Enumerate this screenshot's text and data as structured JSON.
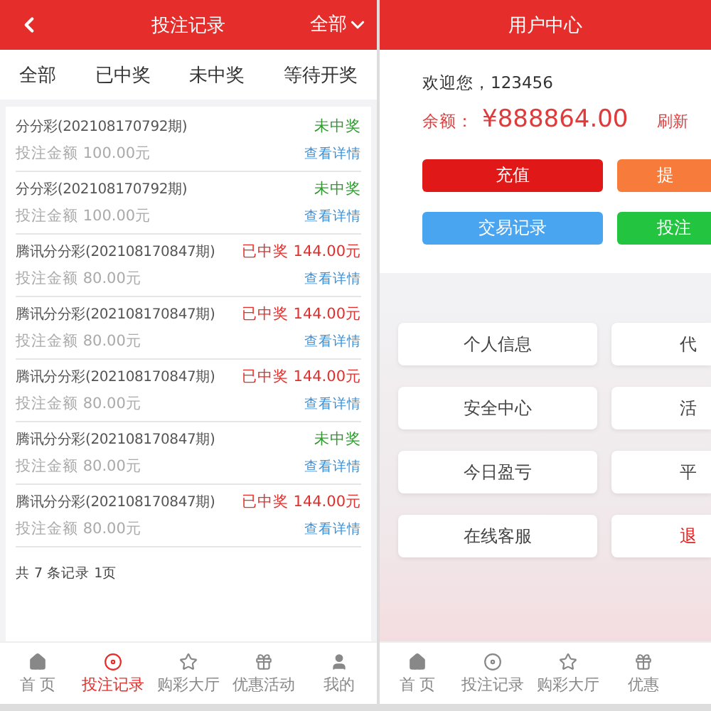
{
  "records_screen": {
    "header": {
      "title": "投注记录",
      "filter": "全部"
    },
    "tabs": [
      {
        "label": "全部"
      },
      {
        "label": "已中奖"
      },
      {
        "label": "未中奖"
      },
      {
        "label": "等待开奖"
      }
    ],
    "records": [
      {
        "name": "分分彩(202108170792期)",
        "kind": "lost",
        "status": "未中奖",
        "amount": "投注金额 100.00元",
        "link": "查看详情"
      },
      {
        "name": "分分彩(202108170792期)",
        "kind": "lost",
        "status": "未中奖",
        "amount": "投注金额 100.00元",
        "link": "查看详情"
      },
      {
        "name": "腾讯分分彩(202108170847期)",
        "kind": "won",
        "status": "已中奖 144.00元",
        "amount": "投注金额 80.00元",
        "link": "查看详情"
      },
      {
        "name": "腾讯分分彩(202108170847期)",
        "kind": "won",
        "status": "已中奖 144.00元",
        "amount": "投注金额 80.00元",
        "link": "查看详情"
      },
      {
        "name": "腾讯分分彩(202108170847期)",
        "kind": "won",
        "status": "已中奖 144.00元",
        "amount": "投注金额 80.00元",
        "link": "查看详情"
      },
      {
        "name": "腾讯分分彩(202108170847期)",
        "kind": "lost",
        "status": "未中奖",
        "amount": "投注金额 80.00元",
        "link": "查看详情"
      },
      {
        "name": "腾讯分分彩(202108170847期)",
        "kind": "won",
        "status": "已中奖 144.00元",
        "amount": "投注金额 80.00元",
        "link": "查看详情"
      }
    ],
    "summary": "共 7 条记录 1页",
    "nav": [
      {
        "label": "首 页",
        "kind": "home",
        "selected": false
      },
      {
        "label": "投注记录",
        "kind": "target",
        "selected": true
      },
      {
        "label": "购彩大厅",
        "kind": "star",
        "selected": false
      },
      {
        "label": "优惠活动",
        "kind": "gift",
        "selected": false
      },
      {
        "label": "我的",
        "kind": "user",
        "selected": false
      }
    ]
  },
  "user_screen": {
    "title": "用户中心",
    "welcome": "欢迎您，123456",
    "balance_label": "余额：",
    "balance": "¥888864.00",
    "refresh": "刷新",
    "actions": [
      {
        "label": "充值",
        "color": "#e01818"
      },
      {
        "label": "提",
        "color": "#f77b3b"
      },
      {
        "label": "交易记录",
        "color": "#4aa5f0"
      },
      {
        "label": "投注",
        "color": "#22c440"
      }
    ],
    "menu": [
      {
        "label": "个人信息",
        "kind": "normal"
      },
      {
        "label": "代",
        "kind": "normal"
      },
      {
        "label": "安全中心",
        "kind": "normal"
      },
      {
        "label": "活",
        "kind": "normal"
      },
      {
        "label": "今日盈亏",
        "kind": "normal"
      },
      {
        "label": "平",
        "kind": "normal"
      },
      {
        "label": "在线客服",
        "kind": "normal"
      },
      {
        "label": "退",
        "kind": "danger"
      }
    ],
    "nav": [
      {
        "label": "首 页",
        "kind": "home",
        "selected": false
      },
      {
        "label": "投注记录",
        "kind": "target",
        "selected": false
      },
      {
        "label": "购彩大厅",
        "kind": "star",
        "selected": false
      },
      {
        "label": "优惠",
        "kind": "gift",
        "selected": false
      }
    ]
  }
}
